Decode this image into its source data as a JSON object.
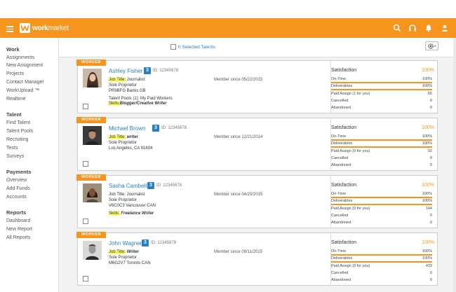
{
  "app": {
    "brand_bold": "work",
    "brand_light": "market"
  },
  "topbar": {
    "icons": [
      "search-icon",
      "headset-icon",
      "bell-icon",
      "user-icon"
    ],
    "color": "#f7941d"
  },
  "sidebar": {
    "sections": [
      {
        "title": "Work",
        "items": [
          "Assignments",
          "New Assignment",
          "Projects",
          "Contact Manager",
          "WorkUpload ™",
          "Realtime"
        ]
      },
      {
        "title": "Talent",
        "items": [
          "Find Talent",
          "Talent Pools",
          "Recruiting",
          "Tests",
          "Surveys"
        ]
      },
      {
        "title": "Payments",
        "items": [
          "Overview",
          "Add Funds",
          "Accounts"
        ]
      },
      {
        "title": "Reports",
        "items": [
          "Dashboard",
          "New Report",
          "All Reports"
        ]
      }
    ]
  },
  "toolbar": {
    "selected_label": "0 Selected Talents"
  },
  "workers": [
    {
      "badge": "WORKER",
      "name": "Ashley Fisher",
      "number": "3",
      "id": "ID: 12345678",
      "member_since": "Member since 05/22/2015",
      "job_title_label": "Job Title:",
      "job_title": "Journalist",
      "line2": "Sole Proprietor",
      "line3": "PR9BFG Banks GB",
      "extra": "Talent Pools (1): My Paid Workers",
      "skills_label": "Skills:",
      "skills": "Blogger/Creative Writer",
      "satisfaction_label": "Satisfaction",
      "satisfaction": "100%",
      "stats": [
        {
          "label": "On-Time",
          "value": "100%",
          "bar": 1.0
        },
        {
          "label": "Deliverables",
          "value": "100%",
          "bar": 1.0
        },
        {
          "label": "Paid Assign (1 for you)",
          "value": "65"
        },
        {
          "label": "Cancelled",
          "value": "0"
        },
        {
          "label": "Abandoned",
          "value": "0"
        }
      ]
    },
    {
      "badge": "WORKER",
      "name": "Michael Brown",
      "number": "3",
      "id": "ID: 12345678",
      "member_since": "Member since 12/21/2014",
      "job_title_label": "Job Title:",
      "job_title": "writer",
      "line2": "Sole Proprietor",
      "line3": "Los Angeles, CA 91604",
      "extra": "",
      "skills_label": "",
      "skills": "",
      "satisfaction_label": "Satisfaction",
      "satisfaction": "100%",
      "stats": [
        {
          "label": "On-Time",
          "value": "100%",
          "bar": 1.0
        },
        {
          "label": "Deliverables",
          "value": "100%",
          "bar": 1.0
        },
        {
          "label": "Paid Assign (0 for you)",
          "value": "92"
        },
        {
          "label": "Cancelled",
          "value": "0"
        },
        {
          "label": "Abandoned",
          "value": "0"
        }
      ]
    },
    {
      "badge": "WORKER",
      "name": "Sasha Cambell",
      "number": "3",
      "id": "ID: 12345678",
      "member_since": "Member since 04/20/2015",
      "job_title_label": "",
      "job_title": "Job Title: Journalist",
      "line2": "Sole Proprietor",
      "line3": "V6C0C3 Vancouver CAN",
      "extra": "",
      "skills_label": "Skills:",
      "skills": "Freelance Writer",
      "satisfaction_label": "Satisfaction",
      "satisfaction": "100%",
      "stats": [
        {
          "label": "On-Time",
          "value": "100%",
          "bar": 1.0
        },
        {
          "label": "Deliverables",
          "value": "100%",
          "bar": 1.0
        },
        {
          "label": "Paid Assign (0 for you)",
          "value": "144"
        },
        {
          "label": "Cancelled",
          "value": "0"
        },
        {
          "label": "Abandoned",
          "value": "0"
        }
      ]
    },
    {
      "badge": "WORKER",
      "name": "John Wagner",
      "number": "3",
      "id": "ID: 12345678",
      "member_since": "Member since 09/11/2015",
      "job_title_label": "Job Title:",
      "job_title": "Writer",
      "line2": "Sole Proprietor",
      "line3": "M6G2V7 Toronto CAN",
      "extra": "",
      "skills_label": "",
      "skills": "",
      "satisfaction_label": "Satisfaction",
      "satisfaction": "100%",
      "stats": [
        {
          "label": "On-Time",
          "value": "100%",
          "bar": 1.0
        },
        {
          "label": "Deliverables",
          "value": "100%",
          "bar": 1.0
        },
        {
          "label": "Paid Assign (0 for you)",
          "value": "433"
        },
        {
          "label": "Cancelled",
          "value": "0"
        },
        {
          "label": "Abandoned",
          "value": "0"
        }
      ]
    }
  ]
}
